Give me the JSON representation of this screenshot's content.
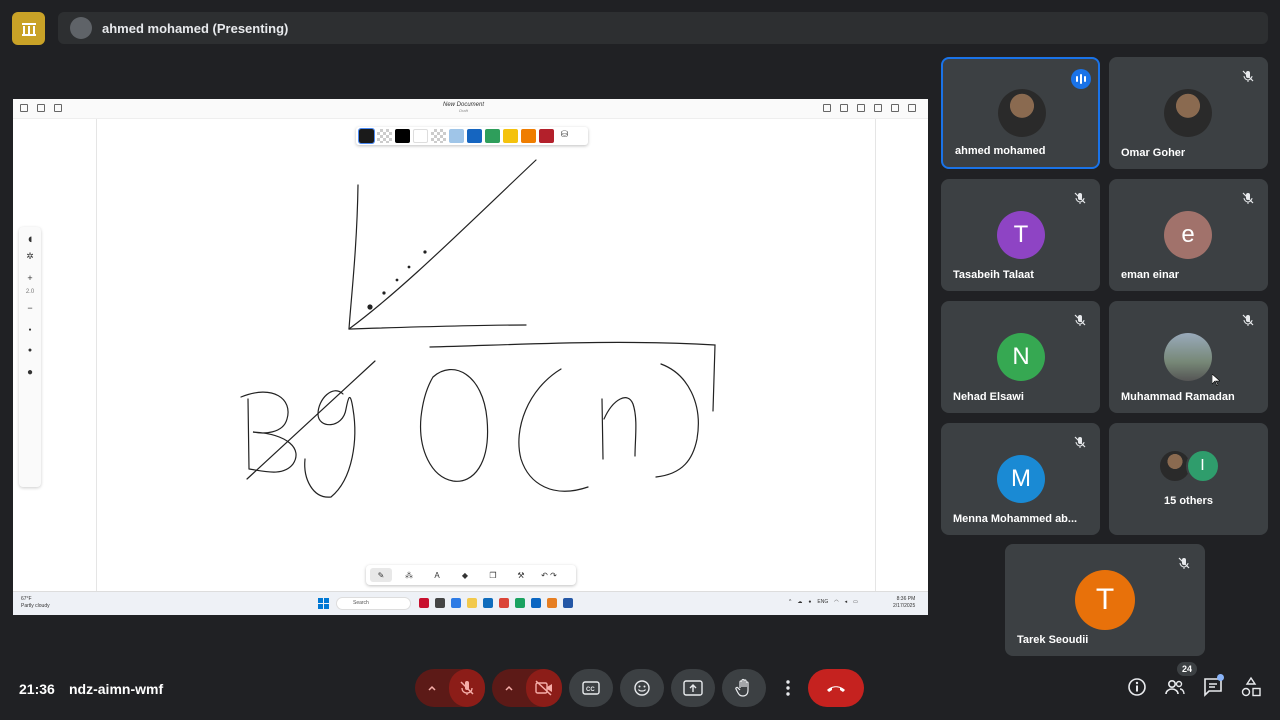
{
  "header": {
    "presenter_label": "ahmed mohamed (Presenting)",
    "logo_icon": "bank-icon"
  },
  "shared_screen": {
    "document_title": "New Document",
    "document_subtitle": "Draft",
    "palette_colors": [
      "#000000",
      "#ffffff",
      "#9fc5e8",
      "#1565c0",
      "#2e9e5b",
      "#f4c20d",
      "#ef7d00",
      "#b3202b"
    ],
    "zoom_level": "2.0",
    "taskbar": {
      "weather_temp": "67°F",
      "weather_desc": "Partly cloudy",
      "search_placeholder": "Search",
      "lang": "ENG",
      "time": "8:36 PM",
      "date": "2/17/2025"
    },
    "drawing_text": "Big O(n)"
  },
  "participants": [
    {
      "name": "ahmed mohamed",
      "initial": "",
      "color": "",
      "muted": false,
      "speaking": true
    },
    {
      "name": "Omar Goher",
      "initial": "",
      "color": "",
      "muted": true,
      "speaking": false
    },
    {
      "name": "Tasabeih Talaat",
      "initial": "T",
      "color": "#8e44c4",
      "muted": true,
      "speaking": false
    },
    {
      "name": "eman einar",
      "initial": "e",
      "color": "#a1726b",
      "muted": true,
      "speaking": false
    },
    {
      "name": "Nehad Elsawi",
      "initial": "N",
      "color": "#36a852",
      "muted": true,
      "speaking": false
    },
    {
      "name": "Muhammad Ramadan",
      "initial": "",
      "color": "",
      "muted": true,
      "speaking": false
    },
    {
      "name": "Menna Mohammed ab...",
      "initial": "M",
      "color": "#1a8ad4",
      "muted": true,
      "speaking": false
    },
    {
      "name": "15 others",
      "initial": "I",
      "color": "#2f9d6c",
      "muted": false,
      "speaking": false
    },
    {
      "name": "Tarek Seoudii",
      "initial": "T",
      "color": "#e8710a",
      "muted": true,
      "speaking": false
    }
  ],
  "footer": {
    "time": "21:36",
    "meeting_code": "ndz-aimn-wmf",
    "people_count": "24"
  }
}
